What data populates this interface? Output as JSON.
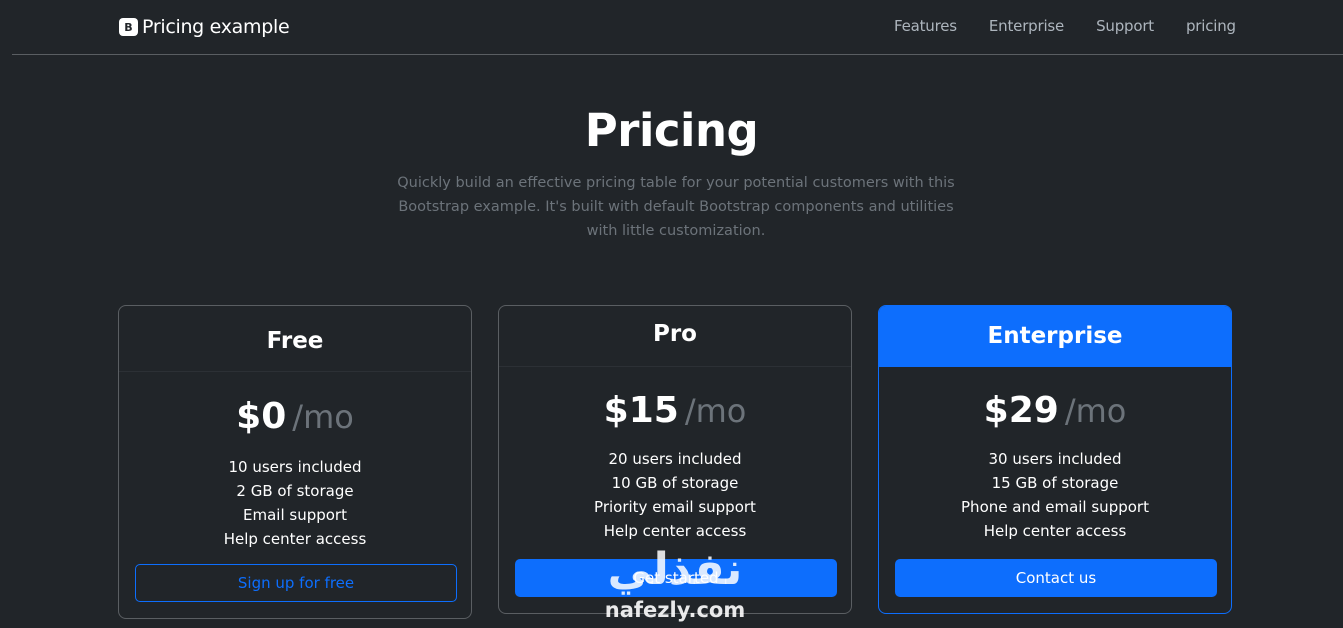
{
  "header": {
    "brand_logo_letter": "B",
    "brand": "Pricing example",
    "nav": [
      "Features",
      "Enterprise",
      "Support",
      "pricing"
    ]
  },
  "hero": {
    "title": "Pricing",
    "lead": "Quickly build an effective pricing table for your potential customers with this Bootstrap example. It's built with default Bootstrap components and utilities with little customization."
  },
  "plans": [
    {
      "name": "Free",
      "price": "$0",
      "period": "/mo",
      "features": [
        "10 users included",
        "2 GB of storage",
        "Email support",
        "Help center access"
      ],
      "button": "Sign up for free"
    },
    {
      "name": "Pro",
      "price": "$15",
      "period": "/mo",
      "features": [
        "20 users included",
        "10 GB of storage",
        "Priority email support",
        "Help center access"
      ],
      "button": "Get started"
    },
    {
      "name": "Enterprise",
      "price": "$29",
      "period": "/mo",
      "features": [
        "30 users included",
        "15 GB of storage",
        "Phone and email support",
        "Help center access"
      ],
      "button": "Contact us"
    }
  ],
  "watermark": {
    "arabic": "نفذلي",
    "latin": "nafezly.com"
  },
  "colors": {
    "background": "#212529",
    "primary": "#0d6efd",
    "muted": "#6c737a",
    "border": "#5a5e62"
  }
}
